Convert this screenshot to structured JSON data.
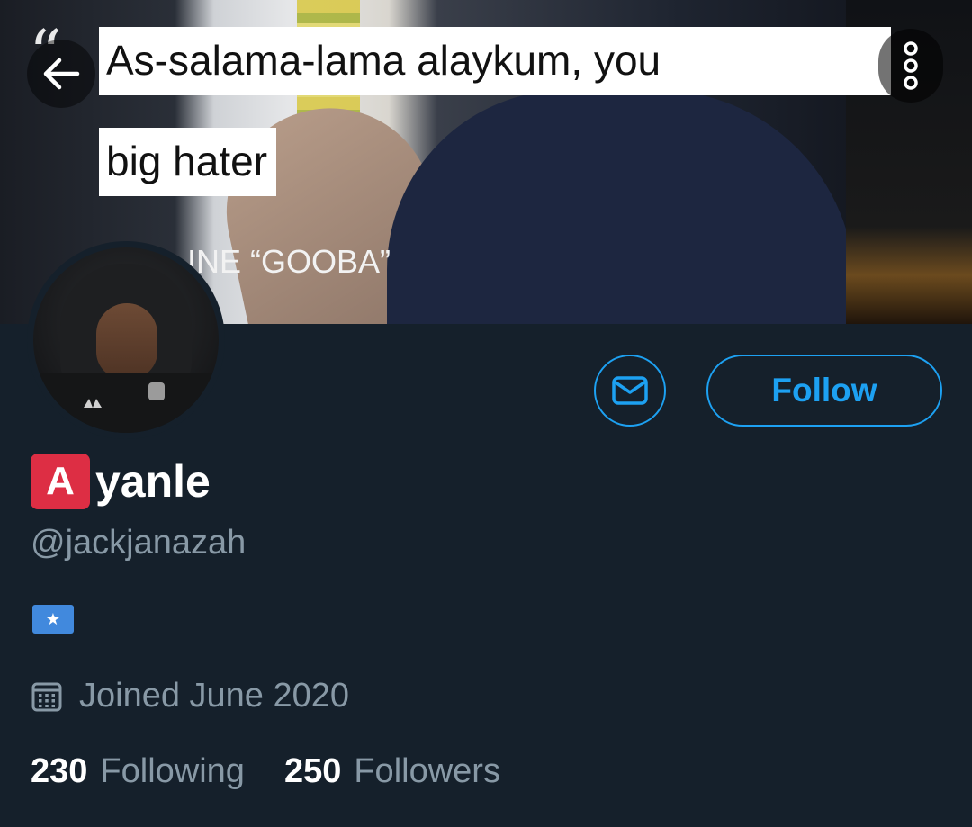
{
  "banner": {
    "caption_line1": "As-salama-lama alaykum, you",
    "caption_line2": "big hater",
    "song_text": "INE “GOOBA”",
    "quote_glyph": "“"
  },
  "header_buttons": {
    "back_icon": "arrow-left-icon",
    "more_icon": "more-vertical-icon"
  },
  "actions": {
    "message_icon": "envelope-icon",
    "follow_label": "Follow",
    "accent_color": "#1da1f2"
  },
  "profile": {
    "name_emoji_letter": "A",
    "name_rest": "yanle",
    "handle": "@jackjanazah",
    "bio_flag": "★",
    "joined_icon": "calendar-icon",
    "joined_text": "Joined June 2020",
    "following_count": "230",
    "following_label": "Following",
    "followers_count": "250",
    "followers_label": "Followers"
  },
  "colors": {
    "background": "#15202b",
    "secondary_text": "#8899a6",
    "emoji_red": "#dd2e44",
    "flag_blue": "#4189dd"
  }
}
